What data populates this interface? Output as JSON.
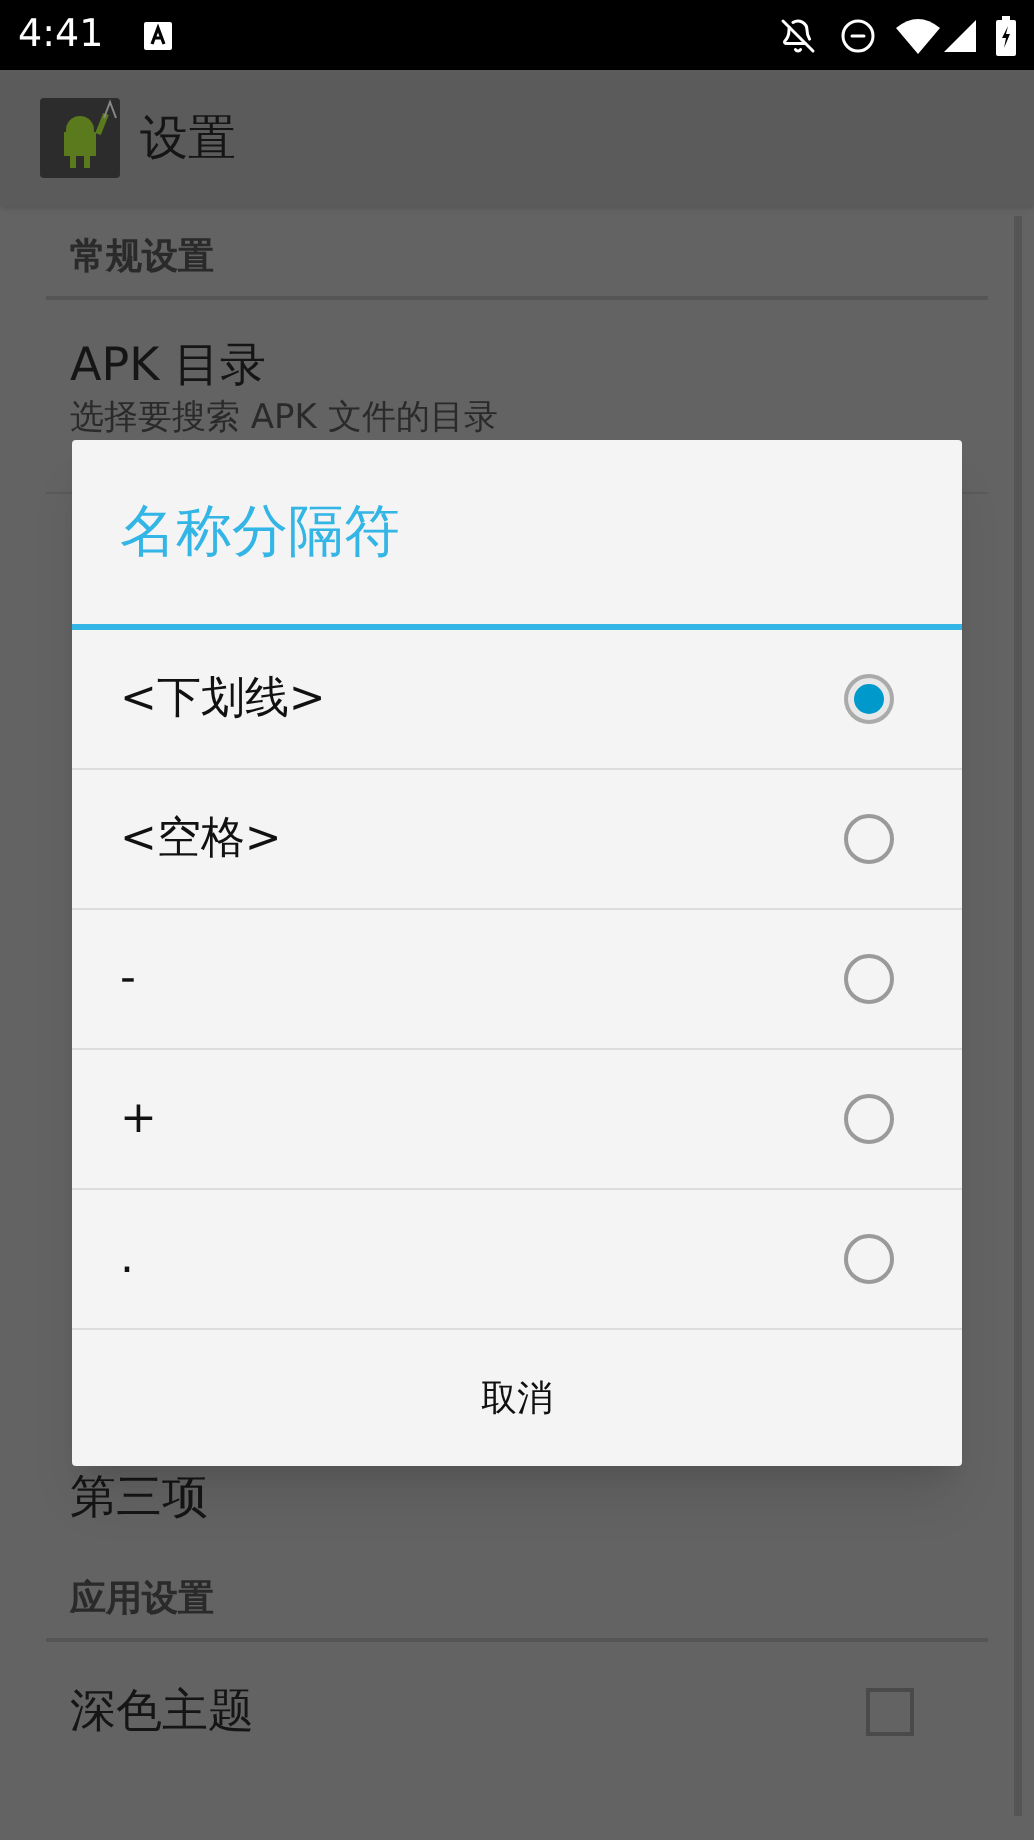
{
  "status_bar": {
    "time": "4:41"
  },
  "app_bar": {
    "title": "设置"
  },
  "sections": [
    {
      "header": "常规设置",
      "items": [
        {
          "kind": "detail",
          "title": "APK 目录",
          "summary": "选择要搜索 APK 文件的目录"
        }
      ]
    },
    {
      "items": [
        {
          "kind": "plain",
          "title": "第三项"
        }
      ]
    },
    {
      "header": "应用设置",
      "items": [
        {
          "kind": "checkbox",
          "title": "深色主题",
          "checked": false
        }
      ]
    }
  ],
  "dialog": {
    "title": "名称分隔符",
    "options": [
      {
        "label": "<下划线>",
        "selected": true
      },
      {
        "label": "<空格>",
        "selected": false
      },
      {
        "label": "-",
        "selected": false
      },
      {
        "label": "+",
        "selected": false
      },
      {
        "label": ".",
        "selected": false
      }
    ],
    "cancel": "取消"
  }
}
